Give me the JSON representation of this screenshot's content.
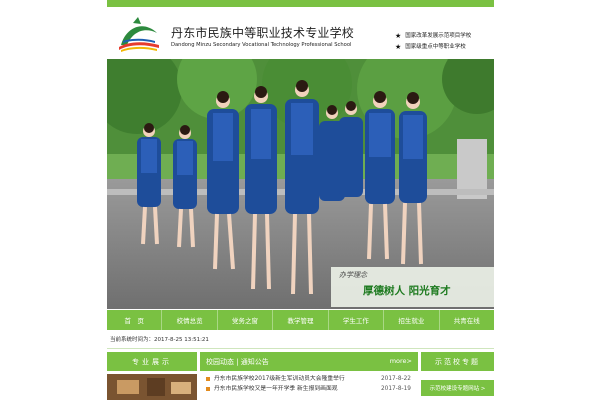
{
  "header": {
    "title_cn": "丹东市民族中等职业技术专业学校",
    "title_en": "Dandong Minzu Secondary Vocational Technology Professional School",
    "badges": [
      "国家改革发展示范项目学校",
      "国家级重点中等职业学校"
    ]
  },
  "banner": {
    "slogan_small": "办学理念",
    "slogan_big": "厚德树人  阳光育才"
  },
  "nav": {
    "items": [
      "首　页",
      "校情总览",
      "党务之窗",
      "教学管理",
      "学生工作",
      "招生就业",
      "共青在线"
    ]
  },
  "timebar": {
    "text": "当前系统时间为：2017-8-25 13:51:21"
  },
  "columns": {
    "left_title": "专业展示",
    "mid_title": "校园动态 | 通知公告",
    "more": "more>",
    "right_title": "示范校专题",
    "right_button": "示范校建设专题网站 >"
  },
  "news": [
    {
      "title": "丹东市民族学校2017级新生军训动员大会隆重举行",
      "date": "2017-8-22"
    },
    {
      "title": "丹东市民族学校又是一年开学季 新生报到画面观",
      "date": "2017-8-19"
    }
  ],
  "colors": {
    "accent": "#7ac142",
    "uniform": "#2c5fb8",
    "slogan": "#1d7a1f"
  }
}
